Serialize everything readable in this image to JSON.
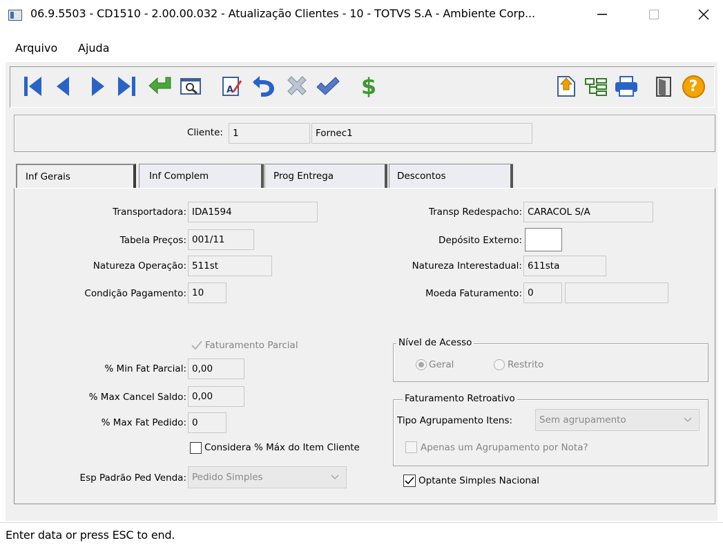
{
  "window": {
    "title": "06.9.5503 - CD1510 - 2.00.00.032 - Atualização Clientes - 10 - TOTVS S.A - Ambiente Corp..."
  },
  "menu": {
    "items": [
      "Arquivo",
      "Ajuda"
    ]
  },
  "toolbar": {
    "left_icons": [
      "first-record-icon",
      "previous-record-icon",
      "next-record-icon",
      "last-record-icon",
      "goto-icon",
      "search-icon",
      "edit-icon",
      "undo-icon",
      "delete-icon",
      "confirm-icon",
      "financial-icon"
    ],
    "right_icons": [
      "navigation-icon",
      "tree-icon",
      "print-icon",
      "exit-icon",
      "help-icon"
    ],
    "help_symbol": "?",
    "financial_symbol": "$"
  },
  "header": {
    "cliente_label": "Cliente:",
    "cliente_code": "1",
    "cliente_name": "Fornec1"
  },
  "tabs": [
    {
      "label": "Inf Gerais",
      "active": true
    },
    {
      "label": "Inf Complem",
      "active": false
    },
    {
      "label": "Prog Entrega",
      "active": false
    },
    {
      "label": "Descontos",
      "active": false
    }
  ],
  "form": {
    "transportadora": {
      "label": "Transportadora:",
      "value": "IDA1594"
    },
    "tabela_precos": {
      "label": "Tabela Preços:",
      "value": "001/11"
    },
    "natureza_operacao": {
      "label": "Natureza Operação:",
      "value": "511st"
    },
    "condicao_pagamento": {
      "label": "Condição Pagamento:",
      "value": "10"
    },
    "transp_redespacho": {
      "label": "Transp Redespacho:",
      "value": "CARACOL S/A"
    },
    "deposito_externo": {
      "label": "Depósito Externo:",
      "value": ""
    },
    "natureza_interestadual": {
      "label": "Natureza Interestadual:",
      "value": "611sta"
    },
    "moeda_faturamento": {
      "label": "Moeda Faturamento:",
      "value": "0",
      "desc": ""
    },
    "faturamento_parcial": {
      "label": "Faturamento Parcial",
      "checked": true
    },
    "min_fat_parcial": {
      "label": "% Min Fat Parcial:",
      "value": "0,00"
    },
    "max_cancel_saldo": {
      "label": "% Max Cancel Saldo:",
      "value": "0,00"
    },
    "max_fat_pedido": {
      "label": "% Max Fat Pedido:",
      "value": "0"
    },
    "considera_max": {
      "label": "Considera % Máx do Item Cliente",
      "checked": false
    },
    "esp_padrao": {
      "label": "Esp Padrão Ped Venda:",
      "value": "Pedido Simples"
    },
    "nivel_acesso": {
      "title": "Nível de Acesso",
      "options": [
        "Geral",
        "Restrito"
      ],
      "selected": "Geral"
    },
    "faturamento_retroativo": {
      "title": "Faturamento Retroativo",
      "tipo_label": "Tipo Agrupamento Itens:",
      "tipo_value": "Sem agrupamento",
      "apenas_label": "Apenas um Agrupamento por Nota?",
      "apenas_checked": false
    },
    "optante_simples": {
      "label": "Optante Simples Nacional",
      "checked": true
    }
  },
  "status": {
    "text": "Enter data or press ESC to end."
  },
  "colors": {
    "toolbar_blue": "#2a63c7",
    "toolbar_green": "#3c9a2f",
    "help_orange": "#f5a300"
  }
}
